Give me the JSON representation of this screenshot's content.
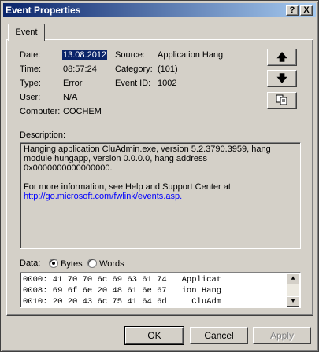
{
  "window": {
    "title": "Event Properties",
    "help_label": "?",
    "close_label": "X"
  },
  "tabs": [
    {
      "label": "Event"
    }
  ],
  "fields": {
    "date": {
      "label": "Date:",
      "value": "13.08.2012"
    },
    "time": {
      "label": "Time:",
      "value": "08:57:24"
    },
    "type": {
      "label": "Type:",
      "value": "Error"
    },
    "user": {
      "label": "User:",
      "value": "N/A"
    },
    "computer": {
      "label": "Computer:",
      "value": "COCHEM"
    },
    "source": {
      "label": "Source:",
      "value": "Application Hang"
    },
    "category": {
      "label": "Category:",
      "value": "(101)"
    },
    "event_id": {
      "label": "Event ID:",
      "value": "1002"
    }
  },
  "side_buttons": {
    "up_icon": "up-arrow-icon",
    "down_icon": "down-arrow-icon",
    "copy_icon": "copy-icon"
  },
  "description": {
    "label": "Description:",
    "text1": "Hanging application CluAdmin.exe, version 5.2.3790.3959, hang module hungapp, version 0.0.0.0, hang address 0x0000000000000000.",
    "text2": "For more information, see Help and Support Center at",
    "link": "http://go.microsoft.com/fwlink/events.asp."
  },
  "data": {
    "label": "Data:",
    "bytes_label": "Bytes",
    "words_label": "Words",
    "selected": "Bytes",
    "rows": [
      "0000: 41 70 70 6c 69 63 61 74   Applicat",
      "0008: 69 6f 6e 20 48 61 6e 67   ion Hang",
      "0010: 20 20 43 6c 75 41 64 6d     CluAdm"
    ]
  },
  "buttons": {
    "ok": "OK",
    "cancel": "Cancel",
    "apply": "Apply"
  }
}
